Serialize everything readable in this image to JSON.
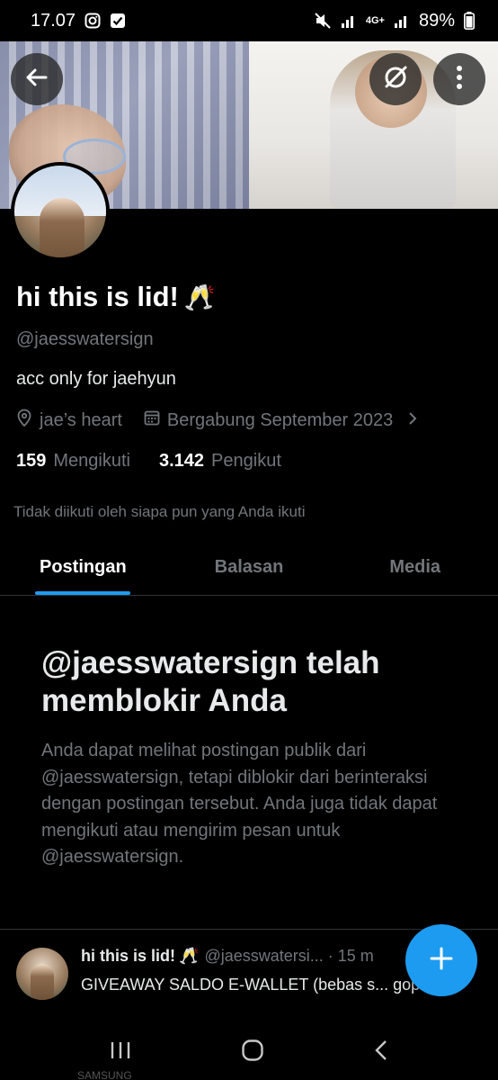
{
  "status_bar": {
    "time": "17.07",
    "network": "4G+",
    "battery": "89%"
  },
  "profile": {
    "name": "hi this is lid!",
    "name_emoji": "🥂",
    "handle": "@jaesswatersign",
    "bio": "acc only for jaehyun",
    "location": "jae’s heart",
    "joined": "Bergabung September 2023",
    "following_count": "159",
    "following_label": "Mengikuti",
    "followers_count": "3.142",
    "followers_label": "Pengikut",
    "not_followed_note": "Tidak diikuti oleh siapa pun yang Anda ikuti"
  },
  "tabs": [
    {
      "label": "Postingan",
      "active": true
    },
    {
      "label": "Balasan",
      "active": false
    },
    {
      "label": "Media",
      "active": false
    }
  ],
  "blocked": {
    "title": "@jaesswatersign telah memblokir Anda",
    "description": "Anda dapat melihat postingan publik dari @jaesswatersign, tetapi diblokir dari berinteraksi dengan postingan tersebut. Anda juga tidak dapat mengikuti atau mengirim pesan untuk @jaesswatersign."
  },
  "post_preview": {
    "name": "hi this is lid!",
    "name_emoji": "🥂",
    "handle_time": "@jaesswatersi... · 15 m",
    "text": "GIVEAWAY SALDO E-WALLET (bebas s... gopay)"
  },
  "colors": {
    "accent": "#1d9bf0",
    "muted": "#71767b",
    "background": "#000000"
  },
  "icons": [
    "back-arrow-icon",
    "grok-icon",
    "more-icon",
    "location-icon",
    "calendar-icon",
    "plus-icon"
  ],
  "nav_bar_caption": "SAMSUNG"
}
